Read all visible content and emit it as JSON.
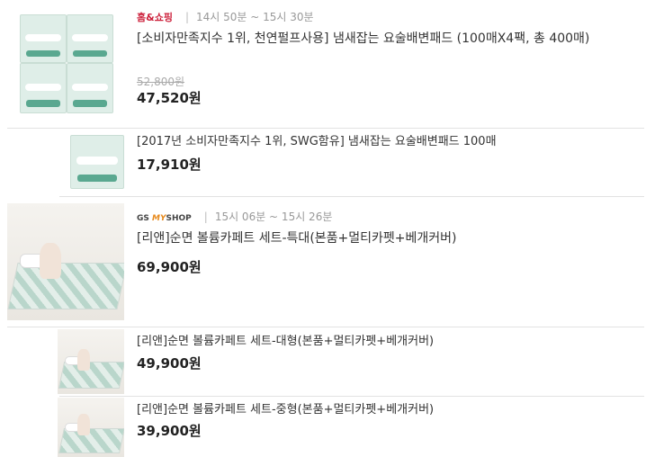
{
  "products": [
    {
      "channel": "홈&쇼핑",
      "time": "14시 50분 ~ 15시 30분",
      "title": "[소비자만족지수 1위, 천연펄프사용] 냄새잡는 요술배변패드 (100매X4팩, 총 400매)",
      "original_price": "52,800원",
      "price": "47,520원"
    },
    {
      "title": "[2017년 소비자만족지수 1위, SWG함유] 냄새잡는 요술배변패드 100매",
      "price": "17,910원"
    },
    {
      "channel_gs": "GS",
      "channel_my": "MY",
      "channel_shop": "SHOP",
      "time": "15시 06분 ~ 15시 26분",
      "title": "[리앤]순면 볼륨카페트 세트-특대(본품+멀티카펫+베개커버)",
      "price": "69,900원"
    },
    {
      "title": "[리앤]순면 볼륨카페트 세트-대형(본품+멀티카펫+베개커버)",
      "price": "49,900원"
    },
    {
      "title": "[리앤]순면 볼륨카페트 세트-중형(본품+멀티카펫+베개커버)",
      "price": "39,900원"
    }
  ],
  "separator": "|"
}
